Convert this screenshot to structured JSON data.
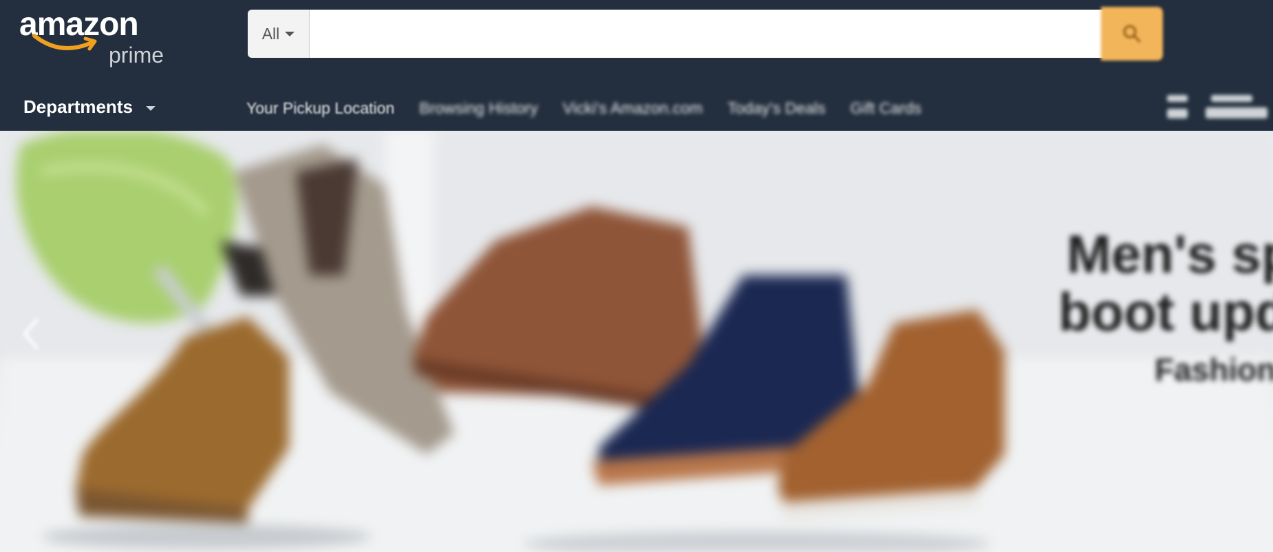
{
  "header": {
    "logo": {
      "wordmark": "amazon",
      "sub": "prime"
    },
    "search": {
      "category": "All",
      "placeholder": "",
      "button_icon": "search-icon"
    },
    "departments_label": "Departments",
    "nav_links": [
      "Your Pickup Location",
      "Browsing History",
      "Vicki's Amazon.com",
      "Today's Deals",
      "Gift Cards"
    ]
  },
  "hero": {
    "headline_line1": "Men's sp",
    "headline_line2": "boot upd",
    "brand": "Fashion",
    "prev_icon": "chevron-left-icon"
  },
  "colors": {
    "header_bg": "#232f3e",
    "search_button": "#f3b55a",
    "smile": "#f0a020"
  }
}
